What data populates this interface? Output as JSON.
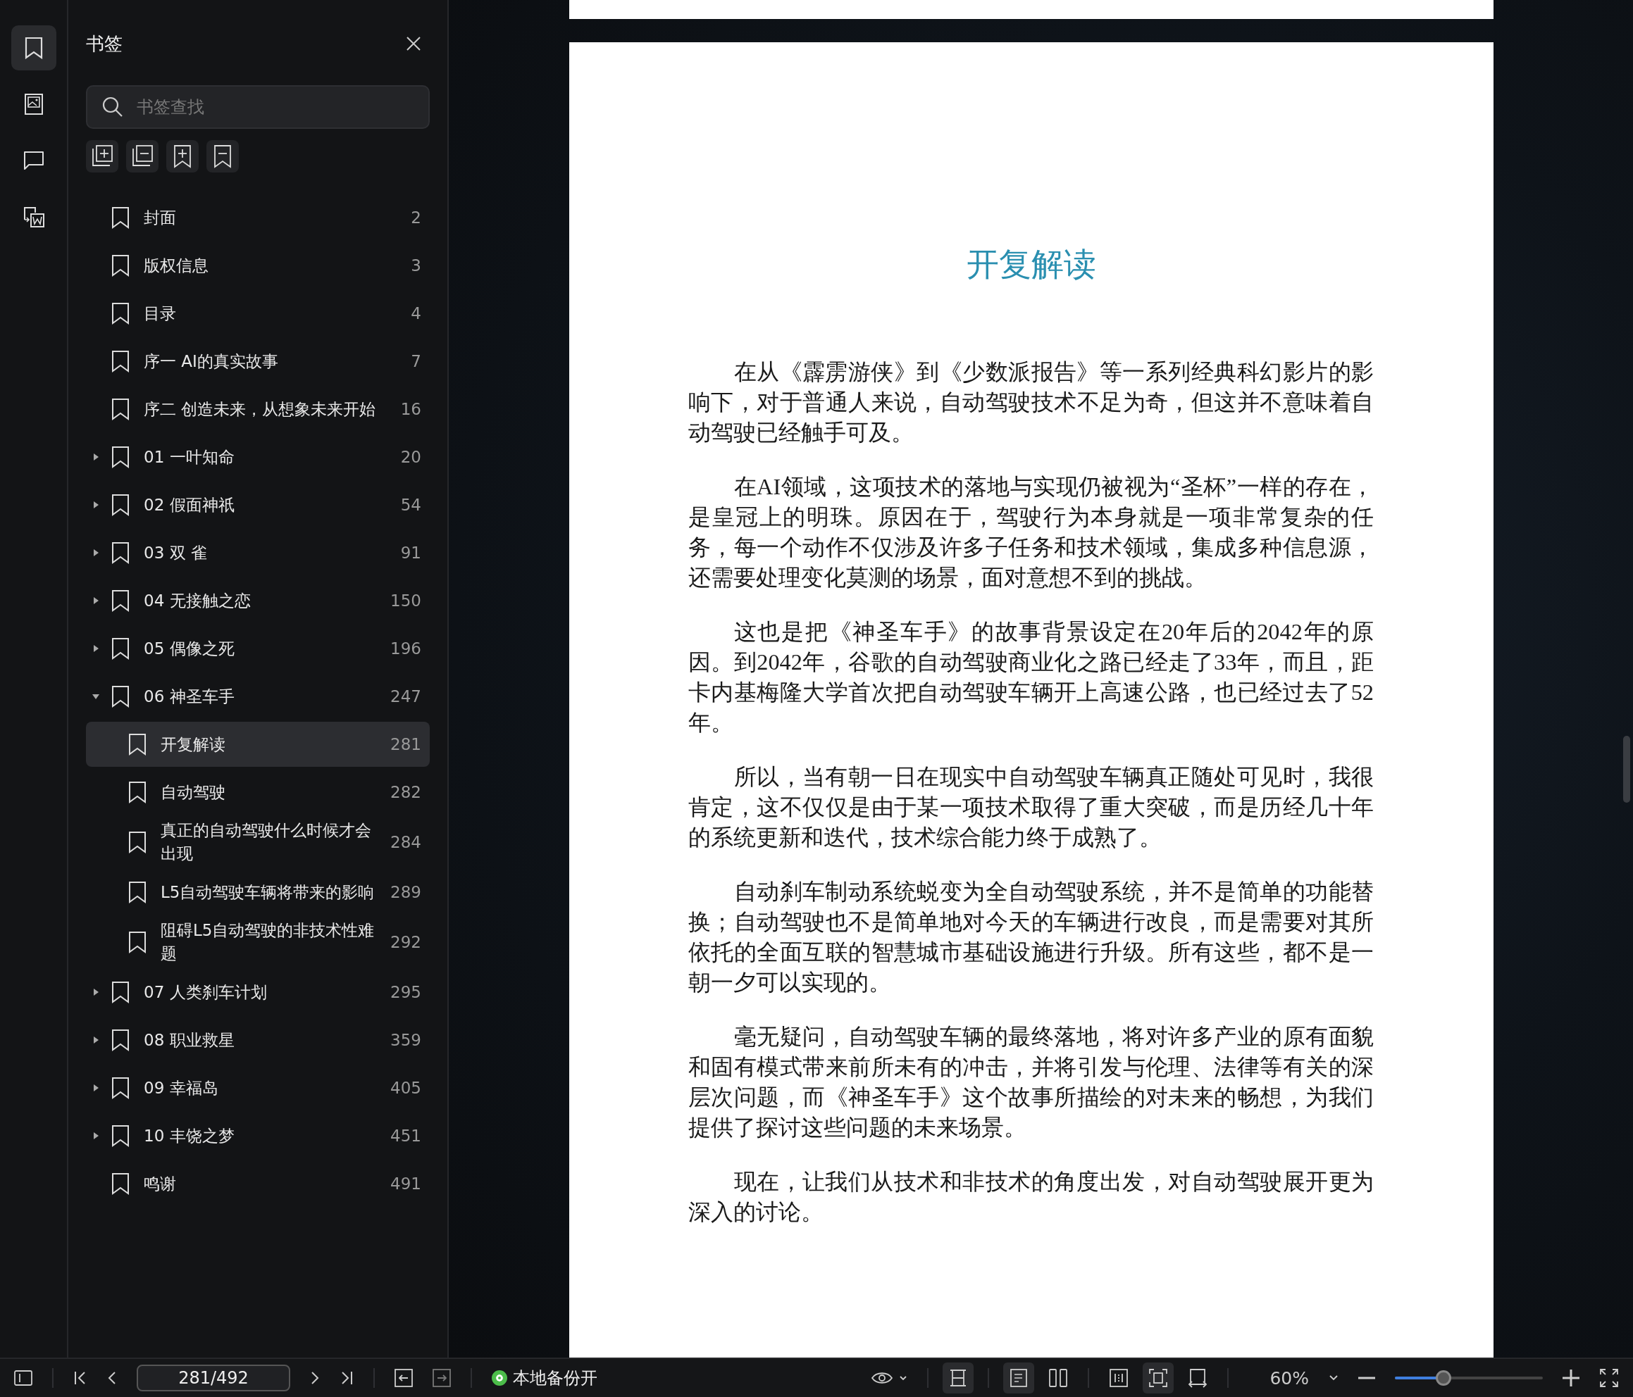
{
  "rail": {
    "items": [
      {
        "kind": "bookmark",
        "selected": true
      },
      {
        "kind": "image",
        "selected": false
      },
      {
        "kind": "comment",
        "selected": false
      },
      {
        "kind": "convert",
        "selected": false
      }
    ]
  },
  "sidebar": {
    "title": "书签",
    "search": {
      "placeholder": "书签查找"
    },
    "tools": [
      {
        "kind": "expand-all"
      },
      {
        "kind": "collapse-all"
      },
      {
        "kind": "add"
      },
      {
        "kind": "remove"
      }
    ],
    "bookmarks": [
      {
        "title": "封面",
        "page": "2",
        "selected": false
      },
      {
        "title": "版权信息",
        "page": "3",
        "selected": false
      },
      {
        "title": "目录",
        "page": "4",
        "selected": false
      },
      {
        "title": "序一 AI的真实故事",
        "page": "7",
        "selected": false
      },
      {
        "title": "序二 创造未来，从想象未来开始",
        "page": "16",
        "selected": false
      },
      {
        "title": "01 一叶知命",
        "page": "20",
        "expanded": false,
        "selected": false
      },
      {
        "title": "02 假面神祇",
        "page": "54",
        "expanded": false,
        "selected": false
      },
      {
        "title": "03 双 雀",
        "page": "91",
        "expanded": false,
        "selected": false
      },
      {
        "title": "04 无接触之恋",
        "page": "150",
        "expanded": false,
        "selected": false
      },
      {
        "title": "05 偶像之死",
        "page": "196",
        "expanded": false,
        "selected": false
      },
      {
        "title": "06 神圣车手",
        "page": "247",
        "expanded": true,
        "selected": false,
        "children": [
          {
            "title": "开复解读",
            "page": "281",
            "selected": true
          },
          {
            "title": "自动驾驶",
            "page": "282",
            "selected": false
          },
          {
            "title": "真正的自动驾驶什么时候才会出现",
            "page": "284",
            "selected": false
          },
          {
            "title": "L5自动驾驶车辆将带来的影响",
            "page": "289",
            "selected": false
          },
          {
            "title": "阻碍L5自动驾驶的非技术性难题",
            "page": "292",
            "selected": false
          }
        ]
      },
      {
        "title": "07 人类刹车计划",
        "page": "295",
        "expanded": false,
        "selected": false
      },
      {
        "title": "08 职业救星",
        "page": "359",
        "expanded": false,
        "selected": false
      },
      {
        "title": "09 幸福岛",
        "page": "405",
        "expanded": false,
        "selected": false
      },
      {
        "title": "10 丰饶之梦",
        "page": "451",
        "expanded": false,
        "selected": false
      },
      {
        "title": "鸣谢",
        "page": "491",
        "selected": false
      }
    ]
  },
  "document": {
    "heading": "开复解读",
    "paragraphs": [
      "在从《霹雳游侠》到《少数派报告》等一系列经典科幻影片的影响下，对于普通人来说，自动驾驶技术不足为奇，但这并不意味着自动驾驶已经触手可及。",
      "在AI领域，这项技术的落地与实现仍被视为“圣杯”一样的存在，是皇冠上的明珠。原因在于，驾驶行为本身就是一项非常复杂的任务，每一个动作不仅涉及许多子任务和技术领域，集成多种信息源，还需要处理变化莫测的场景，面对意想不到的挑战。",
      "这也是把《神圣车手》的故事背景设定在20年后的2042年的原因。到2042年，谷歌的自动驾驶商业化之路已经走了33年，而且，距卡内基梅隆大学首次把自动驾驶车辆开上高速公路，也已经过去了52年。",
      "所以，当有朝一日在现实中自动驾驶车辆真正随处可见时，我很肯定，这不仅仅是由于某一项技术取得了重大突破，而是历经几十年的系统更新和迭代，技术综合能力终于成熟了。",
      "自动刹车制动系统蜕变为全自动驾驶系统，并不是简单的功能替换；自动驾驶也不是简单地对今天的车辆进行改良，而是需要对其所依托的全面互联的智慧城市基础设施进行升级。所有这些，都不是一朝一夕可以实现的。",
      "毫无疑问，自动驾驶车辆的最终落地，将对许多产业的原有面貌和固有模式带来前所未有的冲击，并将引发与伦理、法律等有关的深层次问题，而《神圣车手》这个故事所描绘的对未来的畅想，为我们提供了探讨这些问题的未来场景。",
      "现在，让我们从技术和非技术的角度出发，对自动驾驶展开更为深入的讨论。"
    ]
  },
  "status_bar": {
    "page_field": "281/492",
    "backup": {
      "label": "本地备份开",
      "on": true
    },
    "view_buttons": [
      {
        "kind": "continuous",
        "selected": true
      },
      {
        "kind": "single",
        "selected": true
      },
      {
        "kind": "double",
        "selected": false
      },
      {
        "kind": "split",
        "selected": false
      },
      {
        "kind": "fit-page",
        "selected": true
      },
      {
        "kind": "fit-width",
        "selected": false
      }
    ],
    "zoom": {
      "value": "60%",
      "level": 0.33
    }
  }
}
